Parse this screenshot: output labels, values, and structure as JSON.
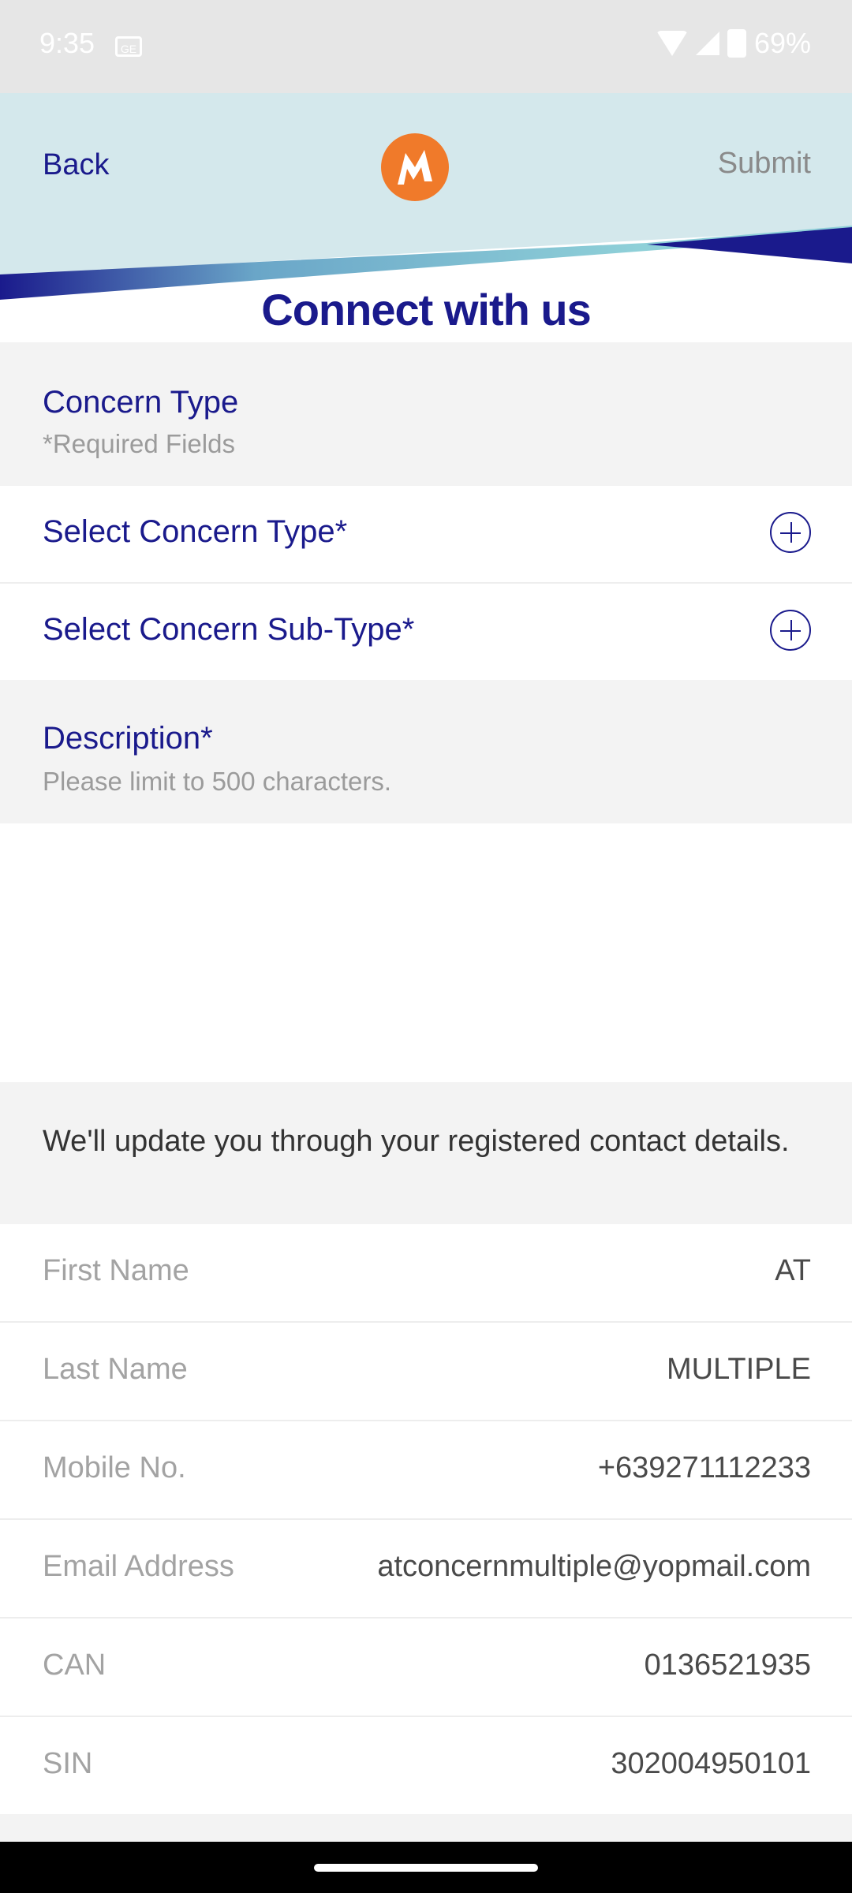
{
  "status_bar": {
    "time": "9:35",
    "sim_icon_label": "GE",
    "battery": "69%"
  },
  "header": {
    "back_label": "Back",
    "submit_label": "Submit",
    "title": "Connect with us"
  },
  "concern_section": {
    "title": "Concern Type",
    "subtitle": "*Required Fields"
  },
  "selectors": [
    {
      "label": "Select Concern Type*"
    },
    {
      "label": "Select Concern Sub-Type*"
    }
  ],
  "description_section": {
    "title": "Description*",
    "subtitle": "Please limit to 500 characters.",
    "value": ""
  },
  "contact_info": {
    "text": "We'll update you through your registered contact details."
  },
  "fields": [
    {
      "label": "First Name",
      "value": "AT"
    },
    {
      "label": "Last Name",
      "value": "MULTIPLE"
    },
    {
      "label": "Mobile No.",
      "value": "+639271112233"
    },
    {
      "label": "Email Address",
      "value": "atconcernmultiple@yopmail.com"
    },
    {
      "label": "CAN",
      "value": "0136521935"
    },
    {
      "label": "SIN",
      "value": "302004950101"
    }
  ],
  "colors": {
    "brand_navy": "#1a1a8c",
    "brand_orange": "#f07a2a",
    "header_bg": "#d4e8ec",
    "section_bg": "#f3f3f3"
  },
  "icons": [
    "wifi-icon",
    "signal-icon",
    "battery-icon",
    "brand-logo",
    "plus-circle-icon"
  ]
}
